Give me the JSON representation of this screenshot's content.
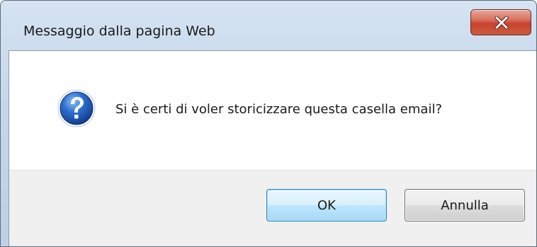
{
  "window": {
    "title": "Messaggio dalla pagina Web",
    "close_icon": "close-icon"
  },
  "message": {
    "icon": "question-icon",
    "text": "Si è certi di voler storicizzare questa casella email?"
  },
  "buttons": {
    "ok_label": "OK",
    "cancel_label": "Annulla"
  },
  "colors": {
    "frame": "#c4d6ea",
    "close_button": "#c6432f",
    "ok_border": "#3c7fb1",
    "button_area": "#f0f0f0",
    "question_icon": "#2a5fb0"
  }
}
